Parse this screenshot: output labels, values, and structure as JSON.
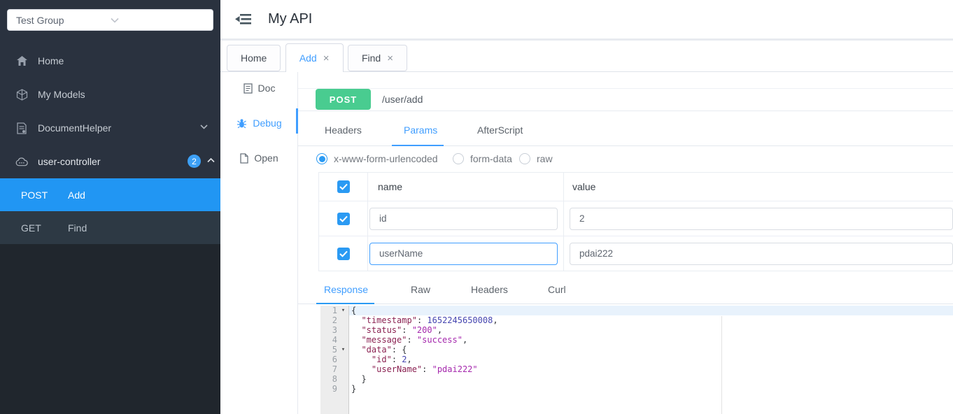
{
  "sidebar": {
    "group_select": {
      "value": "Test Group"
    },
    "items": [
      {
        "label": "Home"
      },
      {
        "label": "My Models"
      },
      {
        "label": "DocumentHelper"
      },
      {
        "label": "user-controller",
        "badge": "2"
      }
    ],
    "endpoints": [
      {
        "method": "POST",
        "label": "Add"
      },
      {
        "method": "GET",
        "label": "Find"
      }
    ]
  },
  "header": {
    "title": "My API"
  },
  "tabs": {
    "items": [
      {
        "label": "Home"
      },
      {
        "label": "Add",
        "close": "×"
      },
      {
        "label": "Find",
        "close": "×"
      }
    ]
  },
  "mode_nav": {
    "items": [
      {
        "label": "Doc"
      },
      {
        "label": "Debug"
      },
      {
        "label": "Open"
      }
    ]
  },
  "request": {
    "method": "POST",
    "url": "/user/add",
    "tabs": [
      {
        "label": "Headers"
      },
      {
        "label": "Params"
      },
      {
        "label": "AfterScript"
      }
    ],
    "body_types": [
      {
        "label": "x-www-form-urlencoded",
        "selected": true
      },
      {
        "label": "form-data",
        "selected": false
      },
      {
        "label": "raw",
        "selected": false
      }
    ],
    "params_table": {
      "columns": {
        "name": "name",
        "value": "value"
      },
      "rows": [
        {
          "checked": true,
          "name": "id",
          "value": "2"
        },
        {
          "checked": true,
          "name": "userName",
          "value": "pdai222"
        }
      ]
    }
  },
  "response": {
    "tabs": [
      {
        "label": "Response"
      },
      {
        "label": "Raw"
      },
      {
        "label": "Headers"
      },
      {
        "label": "Curl"
      }
    ],
    "code": {
      "fold_glyph": "▾",
      "lines": [
        {
          "num": 1,
          "fold": true,
          "active": true,
          "segments": [
            [
              "p",
              "{"
            ]
          ]
        },
        {
          "num": 2,
          "fold": false,
          "active": false,
          "segments": [
            [
              "p",
              "  "
            ],
            [
              "k",
              "\"timestamp\""
            ],
            [
              "p",
              ": "
            ],
            [
              "n",
              "1652245650008"
            ],
            [
              "p",
              ","
            ]
          ]
        },
        {
          "num": 3,
          "fold": false,
          "active": false,
          "segments": [
            [
              "p",
              "  "
            ],
            [
              "k",
              "\"status\""
            ],
            [
              "p",
              ": "
            ],
            [
              "s",
              "\"200\""
            ],
            [
              "p",
              ","
            ]
          ]
        },
        {
          "num": 4,
          "fold": false,
          "active": false,
          "segments": [
            [
              "p",
              "  "
            ],
            [
              "k",
              "\"message\""
            ],
            [
              "p",
              ": "
            ],
            [
              "s",
              "\"success\""
            ],
            [
              "p",
              ","
            ]
          ]
        },
        {
          "num": 5,
          "fold": true,
          "active": false,
          "segments": [
            [
              "p",
              "  "
            ],
            [
              "k",
              "\"data\""
            ],
            [
              "p",
              ": {"
            ]
          ]
        },
        {
          "num": 6,
          "fold": false,
          "active": false,
          "segments": [
            [
              "p",
              "    "
            ],
            [
              "k",
              "\"id\""
            ],
            [
              "p",
              ": "
            ],
            [
              "n",
              "2"
            ],
            [
              "p",
              ","
            ]
          ]
        },
        {
          "num": 7,
          "fold": false,
          "active": false,
          "segments": [
            [
              "p",
              "    "
            ],
            [
              "k",
              "\"userName\""
            ],
            [
              "p",
              ": "
            ],
            [
              "s",
              "\"pdai222\""
            ]
          ]
        },
        {
          "num": 8,
          "fold": false,
          "active": false,
          "segments": [
            [
              "p",
              "  "
            ],
            [
              "p",
              "}"
            ]
          ]
        },
        {
          "num": 9,
          "fold": false,
          "active": false,
          "segments": [
            [
              "p",
              "}"
            ]
          ]
        }
      ]
    }
  },
  "colors": {
    "sidebar_active_bg": "#2196f3",
    "accent_blue": "#409eff",
    "method_post_green": "#49cc90",
    "checkbox_blue": "#2b9af3",
    "json_key": "#8b2252",
    "json_string": "#a528ad",
    "json_number": "#4545b0"
  }
}
